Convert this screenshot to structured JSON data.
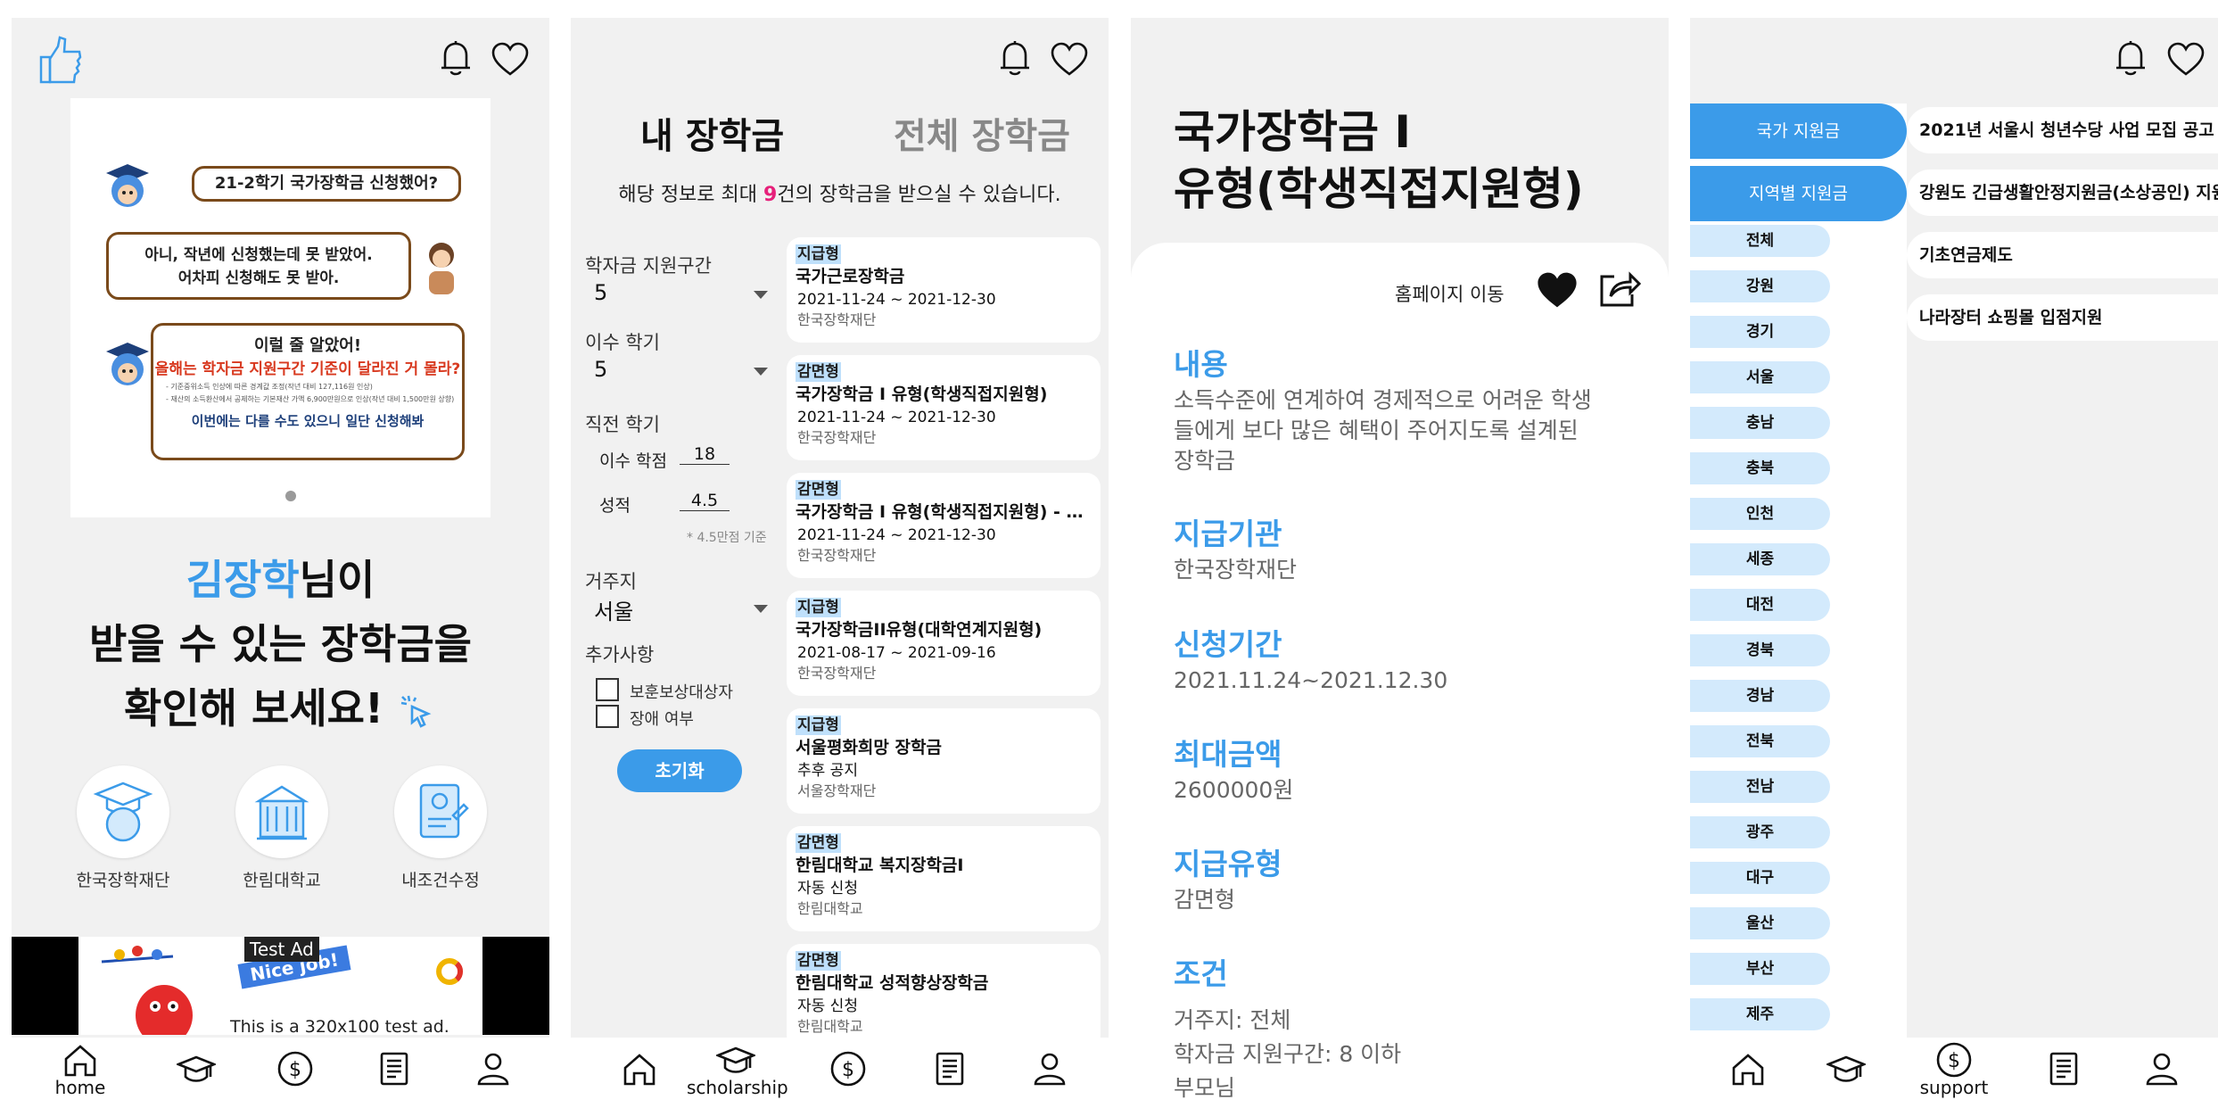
{
  "colors": {
    "accent": "#3b9be9",
    "highlight": "#e6207a",
    "tag_bg": "#bfe0fb",
    "region_bg": "#d3eafc"
  },
  "nav": {
    "home_label": "home",
    "scholarship_label": "scholarship",
    "support_label": "support",
    "icons": [
      "home-icon",
      "graduation-cap-icon",
      "dollar-coin-icon",
      "newspaper-icon",
      "user-icon"
    ]
  },
  "home": {
    "banner": {
      "q1": "21-2학기 국가장학금 신청했어?",
      "a1_line1": "아니, 작년에 신청했는데 못 받았어.",
      "a1_line2": "어차피 신청해도 못 받아.",
      "b_line1": "이럴 줄 알았어!",
      "b_line2": "올해는 학자금 지원구간 기준이 달라진 거 몰라?",
      "b_note1": "- 기준중위소득 인상에 따른 경계값 조정(작년 대비 127,116원 인상)",
      "b_note2": "- 재산의 소득환산에서 공제하는 기본재산 가액 6,900만원으로 인상(작년 대비 1,500만원 상향)",
      "b_line3": "이번에는 다를 수도 있으니 일단 신청해봐"
    },
    "user_name": "김장학",
    "hero_suffix": "님이",
    "hero_line2": "받을 수 있는 장학금을",
    "hero_line3": "확인해 보세요!",
    "shortcuts": [
      {
        "label": "한국장학재단",
        "icon": "globe-cap-icon"
      },
      {
        "label": "한림대학교",
        "icon": "university-icon"
      },
      {
        "label": "내조건수정",
        "icon": "profile-edit-icon"
      }
    ],
    "ad": {
      "badge": "Test Ad",
      "banner_text": "Nice job!",
      "line": "This is a 320x100 test ad."
    }
  },
  "scholarship": {
    "tab_mine": "내 장학금",
    "tab_all": "전체 장학금",
    "info_prefix": "해당 정보로 최대",
    "info_count": "9",
    "info_suffix": "건의 장학금을 받으실 수 있습니다.",
    "filters": {
      "band_label": "학자금 지원구간",
      "band_value": "5",
      "semester_label": "이수 학기",
      "semester_value": "5",
      "prev_label": "직전 학기",
      "credits_label": "이수 학점",
      "credits_value": "18",
      "grade_label": "성적",
      "grade_value": "4.5",
      "grade_hint": "* 4.5만점 기준",
      "residence_label": "거주지",
      "residence_value": "서울",
      "extra_label": "추가사항",
      "check1": "보훈보상대상자",
      "check2": "장애 여부",
      "reset": "초기화"
    },
    "cards": [
      {
        "tag": "지급형",
        "title": "국가근로장학금",
        "period": "2021-11-24 ~ 2021-12-30",
        "org": "한국장학재단"
      },
      {
        "tag": "감면형",
        "title": "국가장학금 I 유형(학생직접지원형)",
        "period": "2021-11-24 ~ 2021-12-30",
        "org": "한국장학재단"
      },
      {
        "tag": "감면형",
        "title": "국가장학금 I 유형(학생직접지원형) - 다자녀",
        "period": "2021-11-24 ~ 2021-12-30",
        "org": "한국장학재단"
      },
      {
        "tag": "지급형",
        "title": "국가장학금II유형(대학연계지원형)",
        "period": "2021-08-17 ~ 2021-09-16",
        "org": "한국장학재단"
      },
      {
        "tag": "지급형",
        "title": "서울평화희망 장학금",
        "period": "추후 공지",
        "org": "서울장학재단"
      },
      {
        "tag": "감면형",
        "title": "한림대학교 복지장학금I",
        "period": "자동 신청",
        "org": "한림대학교"
      },
      {
        "tag": "감면형",
        "title": "한림대학교 성적향상장학금",
        "period": "자동 신청",
        "org": "한림대학교"
      }
    ]
  },
  "detail": {
    "title_line1": "국가장학금 I",
    "title_line2": "유형(학생직접지원형)",
    "homepage_link": "홈페이지 이동",
    "sections": [
      {
        "heading": "내용",
        "text": "소득수준에 연계하여 경제적으로 어려운 학생들에게 보다 많은 혜택이 주어지도록 설계된 장학금"
      },
      {
        "heading": "지급기관",
        "text": "한국장학재단"
      },
      {
        "heading": "신청기간",
        "text": "2021.11.24~2021.12.30"
      },
      {
        "heading": "최대금액",
        "text": "2600000원"
      },
      {
        "heading": "지급유형",
        "text": "감면형"
      },
      {
        "heading": "조건",
        "text": ""
      }
    ],
    "conditions": [
      "거주지: 전체",
      "학자금 지원구간: 8 이하",
      "부모님"
    ]
  },
  "support": {
    "main_tabs": [
      "국가 지원금",
      "지역별 지원금"
    ],
    "regions": [
      "전체",
      "강원",
      "경기",
      "서울",
      "충남",
      "충북",
      "인천",
      "세종",
      "대전",
      "경북",
      "경남",
      "전북",
      "전남",
      "광주",
      "대구",
      "울산",
      "부산",
      "제주"
    ],
    "items": [
      "2021년 서울시 청년수당 사업 모집 공고",
      "강원도 긴급생활안정지원금(소상공인) 지원",
      "기초연금제도",
      "나라장터 쇼핑몰 입점지원"
    ]
  }
}
